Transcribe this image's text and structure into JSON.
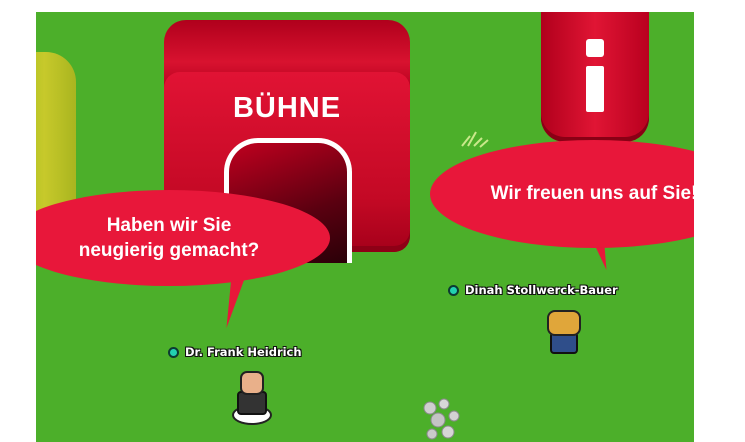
{
  "stage_building": {
    "label": "BÜHNE"
  },
  "info_pillar": {
    "icon": "info-icon"
  },
  "bubbles": [
    {
      "lines": [
        "Haben wir Sie",
        "neugierig gemacht?"
      ]
    },
    {
      "lines": [
        "Wir freuen uns auf Sie!"
      ]
    }
  ],
  "players": [
    {
      "name": "Dr. Frank Heidrich",
      "status": "online"
    },
    {
      "name": "Dinah Stollwerck-Bauer",
      "status": "online"
    }
  ],
  "colors": {
    "grass": "#4caf2a",
    "bubble": "#e8173a",
    "building_red": "#d8122f",
    "status_dot": "#22d1b0"
  }
}
